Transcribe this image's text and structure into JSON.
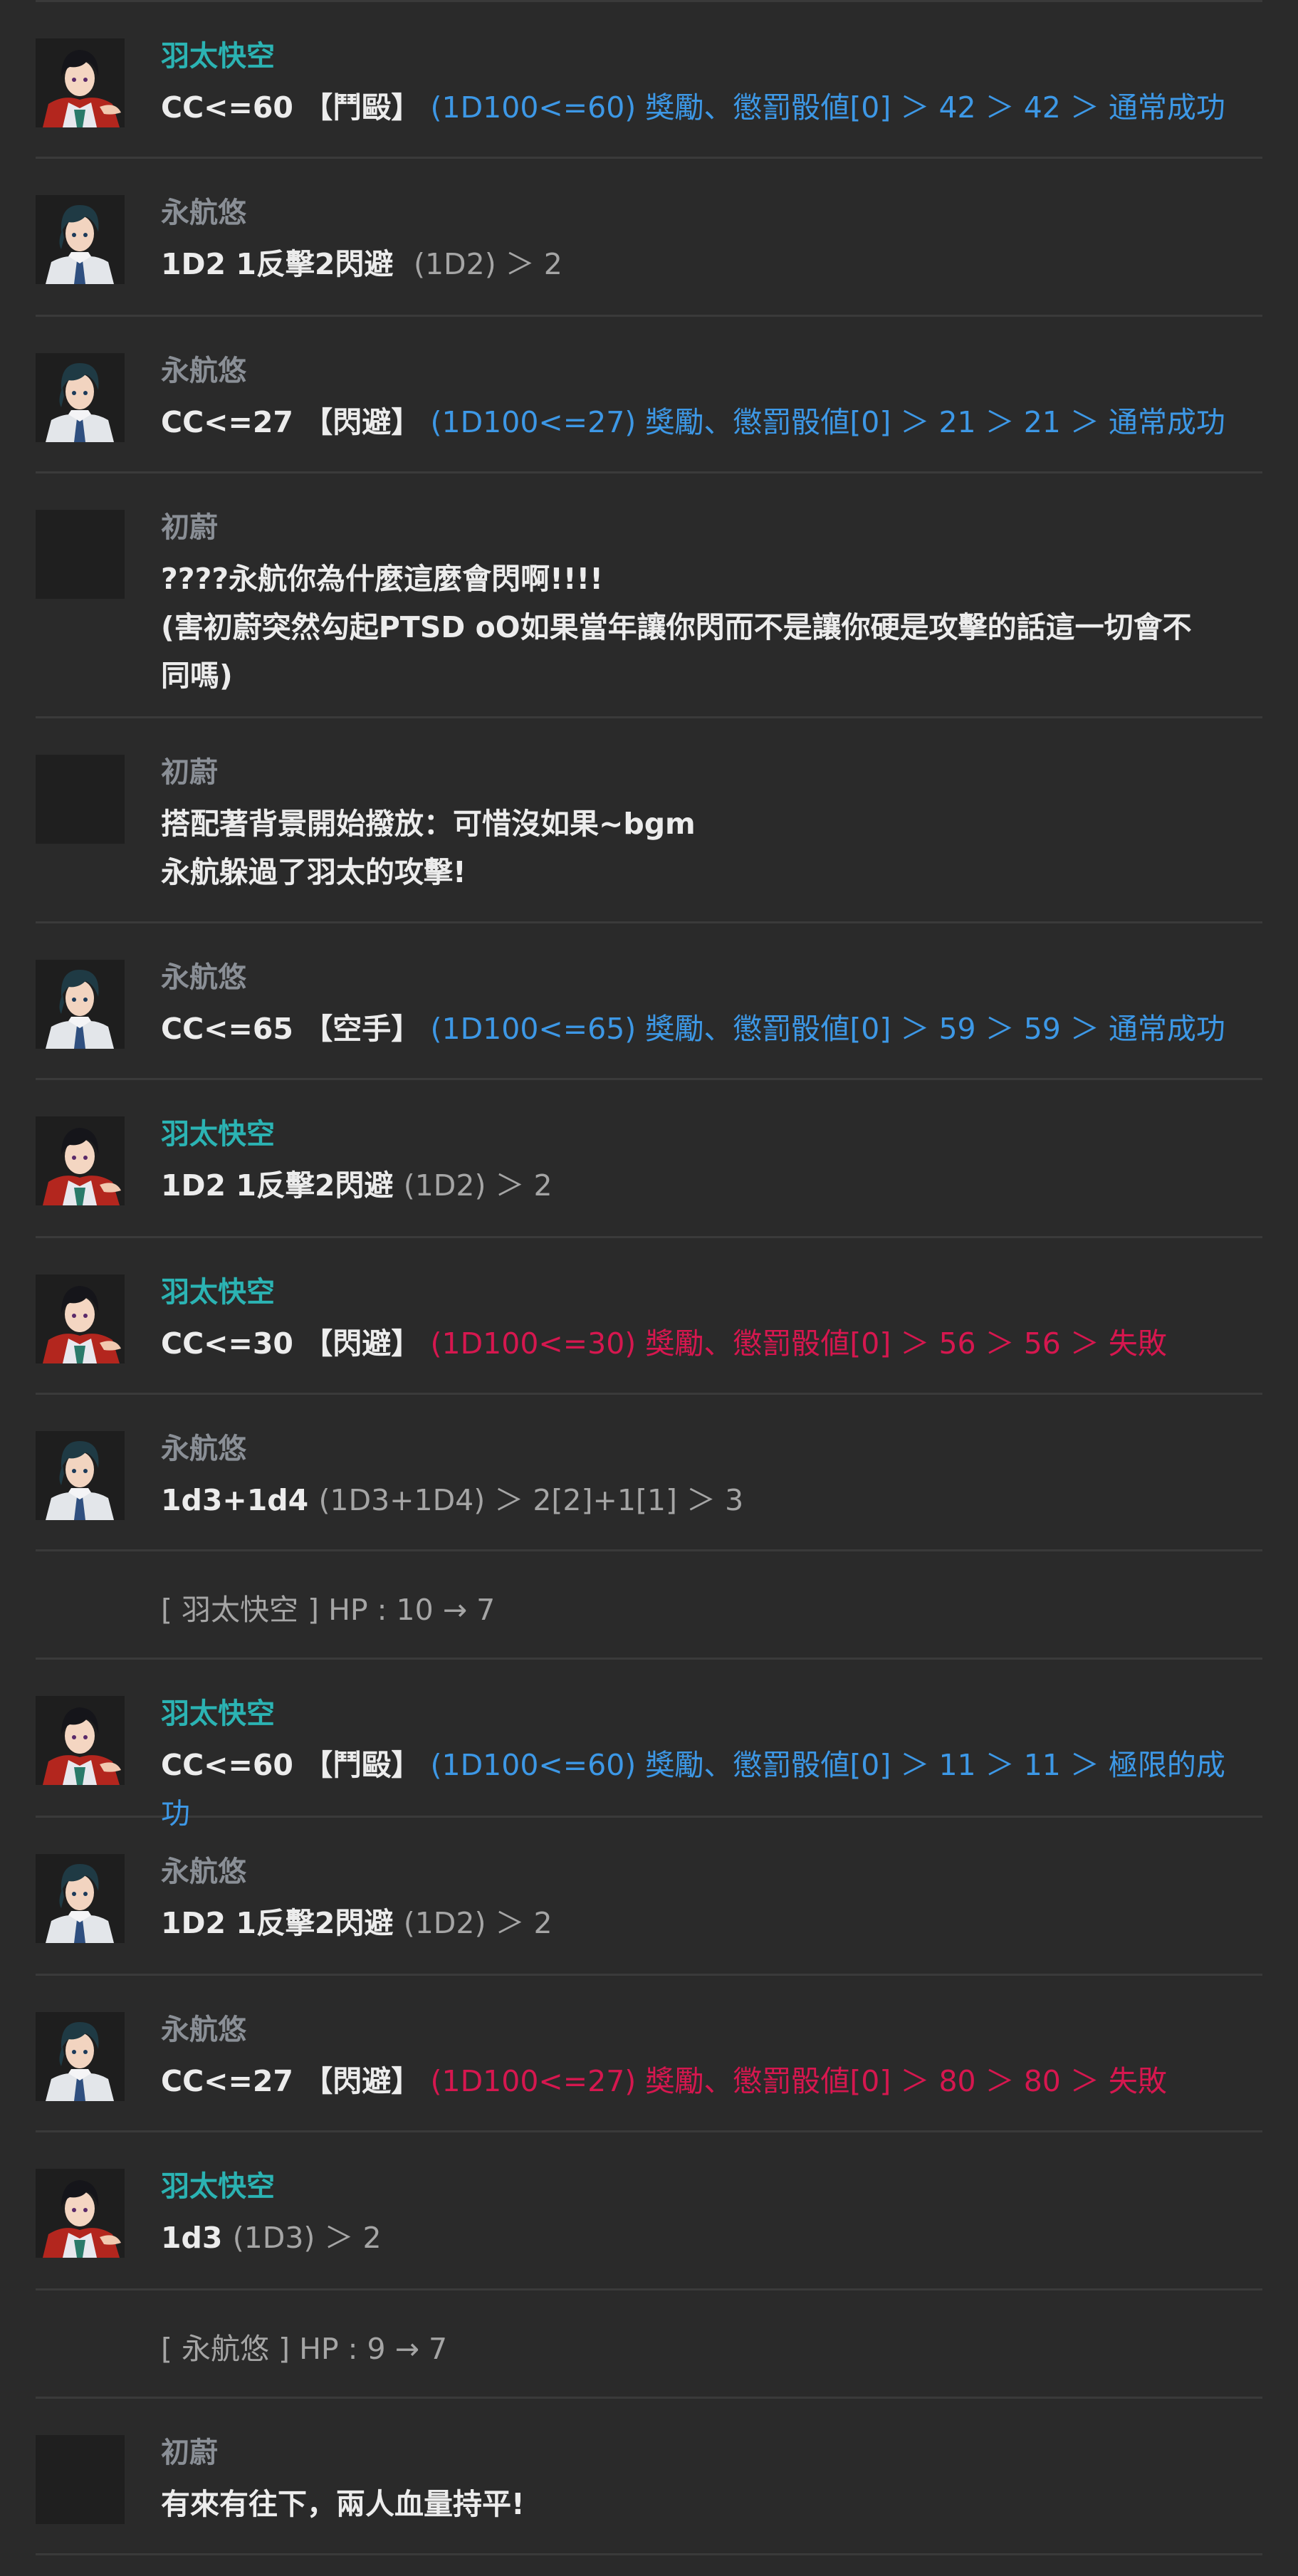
{
  "colors": {
    "background": "#2a2a2a",
    "divider": "#3a3a3a",
    "name_cyan": "#2bb3b3",
    "name_gray": "#8a8f96",
    "success_blue": "#3d98e6",
    "fail_red": "#d6174f",
    "result_gray": "#a5a5a5"
  },
  "messages": [
    {
      "speaker": "羽太快空",
      "avatar": "hata-avatar",
      "name_color": "cyan",
      "command": "CC<=60 【鬥毆】",
      "result": "(1D100<=60) 獎勵、懲罰骰値[0] ＞ 42 ＞ 42 ＞ 通常成功",
      "result_color": "blue"
    },
    {
      "speaker": "永航悠",
      "avatar": "yuu-avatar",
      "name_color": "gray",
      "command": "1D2 1反擊2閃避 ",
      "result": "(1D2) ＞ 2",
      "result_color": "gray"
    },
    {
      "speaker": "永航悠",
      "avatar": "yuu-avatar",
      "name_color": "gray",
      "command": "CC<=27 【閃避】",
      "result": "(1D100<=27) 獎勵、懲罰骰値[0] ＞ 21 ＞ 21 ＞ 通常成功",
      "result_color": "blue"
    },
    {
      "speaker": "初蔚",
      "avatar": "blank-avatar",
      "name_color": "gray",
      "lines": [
        "????永航你為什麼這麼會閃啊!!!!",
        "(害初蔚突然勾起PTSD oO如果當年讓你閃而不是讓你硬是攻擊的話這一切會不",
        "同嗎)"
      ]
    },
    {
      "speaker": "初蔚",
      "avatar": "blank-avatar",
      "name_color": "gray",
      "lines": [
        "搭配著背景開始撥放：可惜沒如果~bgm",
        "永航躲過了羽太的攻擊!"
      ]
    },
    {
      "speaker": "永航悠",
      "avatar": "yuu-avatar",
      "name_color": "gray",
      "command": "CC<=65 【空手】",
      "result": "(1D100<=65) 獎勵、懲罰骰値[0] ＞ 59 ＞ 59 ＞ 通常成功",
      "result_color": "blue"
    },
    {
      "speaker": "羽太快空",
      "avatar": "hata-avatar",
      "name_color": "cyan",
      "command": "1D2 1反擊2閃避",
      "result": "(1D2) ＞ 2",
      "result_color": "gray"
    },
    {
      "speaker": "羽太快空",
      "avatar": "hata-avatar",
      "name_color": "cyan",
      "command": "CC<=30 【閃避】",
      "result": "(1D100<=30) 獎勵、懲罰骰値[0] ＞ 56 ＞ 56 ＞ 失敗",
      "result_color": "red"
    },
    {
      "speaker": "永航悠",
      "avatar": "yuu-avatar",
      "name_color": "gray",
      "command": "1d3+1d4",
      "result": "(1D3+1D4) ＞ 2[2]+1[1] ＞ 3",
      "result_color": "gray"
    },
    {
      "system": "[ 羽太快空 ] HP : 10 → 7"
    },
    {
      "speaker": "羽太快空",
      "avatar": "hata-avatar",
      "name_color": "cyan",
      "command": "CC<=60 【鬥毆】",
      "result": "(1D100<=60) 獎勵、懲罰骰値[0] ＞ 11 ＞ 11 ＞ 極限的成功",
      "result_color": "blue"
    },
    {
      "speaker": "永航悠",
      "avatar": "yuu-avatar",
      "name_color": "gray",
      "command": "1D2 1反擊2閃避",
      "result": "(1D2) ＞ 2",
      "result_color": "gray"
    },
    {
      "speaker": "永航悠",
      "avatar": "yuu-avatar",
      "name_color": "gray",
      "command": "CC<=27 【閃避】",
      "result": "(1D100<=27) 獎勵、懲罰骰値[0] ＞ 80 ＞ 80 ＞ 失敗",
      "result_color": "red"
    },
    {
      "speaker": "羽太快空",
      "avatar": "hata-avatar",
      "name_color": "cyan",
      "command": "1d3",
      "result": "(1D3) ＞ 2",
      "result_color": "gray"
    },
    {
      "system": "[ 永航悠 ] HP : 9 → 7"
    },
    {
      "speaker": "初蔚",
      "avatar": "blank-avatar",
      "name_color": "gray",
      "lines": [
        "有來有往下，兩人血量持平!"
      ]
    }
  ]
}
